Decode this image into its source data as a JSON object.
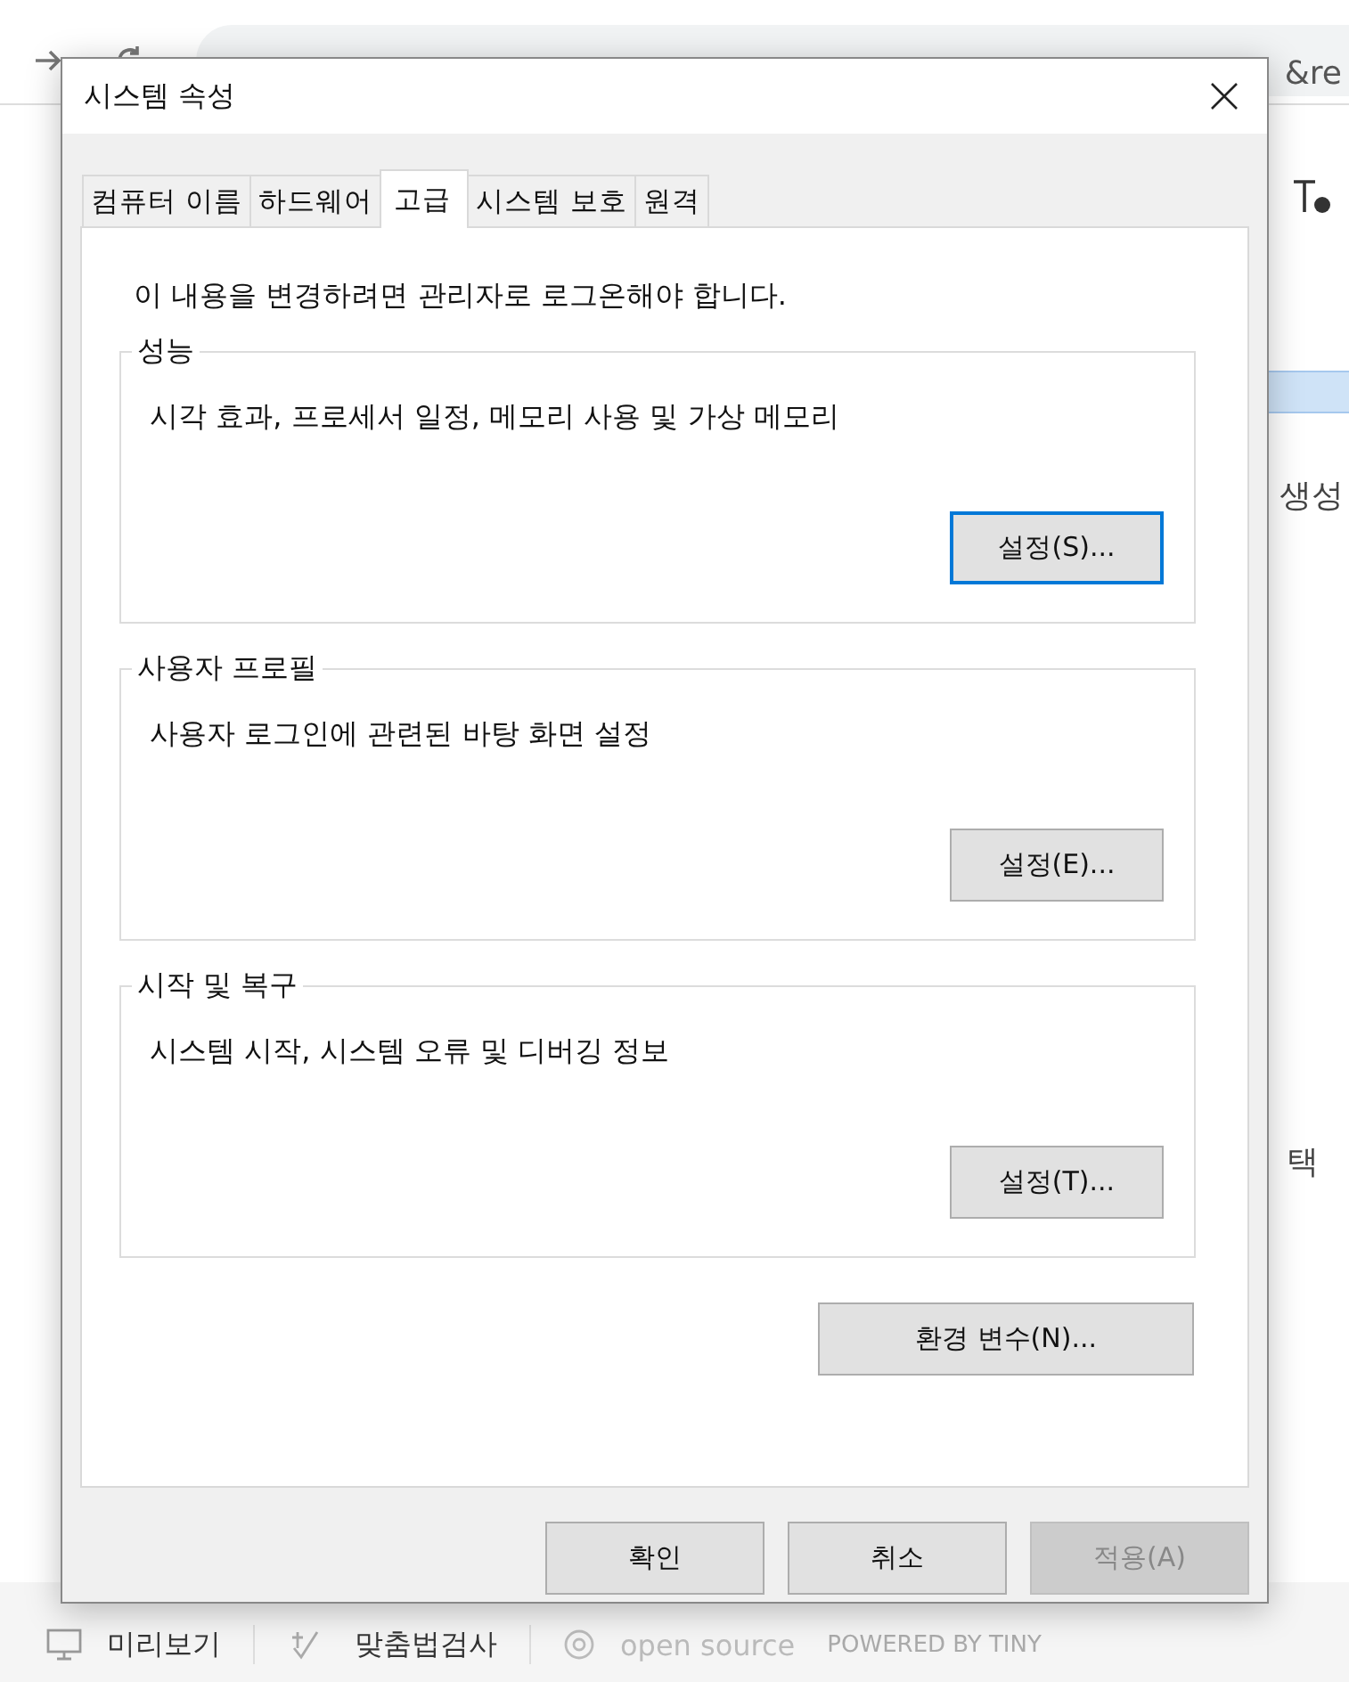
{
  "browser": {
    "address": "&re",
    "side_texts": [
      "생성",
      "택"
    ],
    "footer": [
      {
        "kind": "preview",
        "label": "미리보기"
      },
      {
        "kind": "spell",
        "label": "맞춤법검사"
      },
      {
        "kind": "opensource",
        "label": "open source"
      },
      {
        "kind": "plain",
        "label": "POWERED BY TINY"
      }
    ]
  },
  "dialog": {
    "title": "시스템 속성",
    "tabs": [
      {
        "label": "컴퓨터 이름",
        "selected": false
      },
      {
        "label": "하드웨어",
        "selected": false
      },
      {
        "label": "고급",
        "selected": true
      },
      {
        "label": "시스템 보호",
        "selected": false
      },
      {
        "label": "원격",
        "selected": false
      }
    ],
    "notice": "이 내용을 변경하려면 관리자로 로그온해야 합니다.",
    "groups": [
      {
        "title": "성능",
        "text": "시각 효과, 프로세서 일정, 메모리 사용 및 가상 메모리",
        "button": "설정(S)...",
        "focused": true
      },
      {
        "title": "사용자 프로필",
        "text": "사용자 로그인에 관련된 바탕 화면 설정",
        "button": "설정(E)...",
        "focused": false
      },
      {
        "title": "시작 및 복구",
        "text": "시스템 시작, 시스템 오류 및 디버깅 정보",
        "button": "설정(T)...",
        "focused": false
      }
    ],
    "env_button": "환경 변수(N)...",
    "buttons": [
      {
        "label": "확인",
        "disabled": false
      },
      {
        "label": "취소",
        "disabled": false
      },
      {
        "label": "적용(A)",
        "disabled": true
      }
    ]
  }
}
